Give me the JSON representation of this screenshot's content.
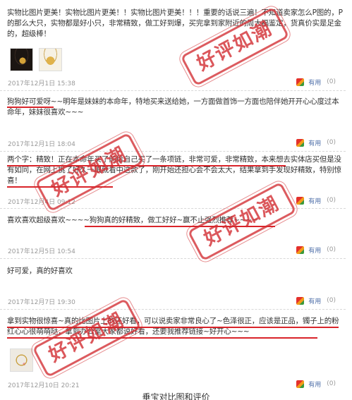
{
  "reviews": [
    {
      "text": "实物比图片更美！实物比图片更美！！实物比图片更美！！！重要的话说三遍！不知道卖家怎么P图的，P的那么大只，实物都是好小只，非常精致，做工好到爆，买完拿到家附近的周大福鉴定，货真价实是足金的，超级棒！",
      "date": "2017年12月1日  15:38",
      "useful": "有用",
      "count": "(0)"
    },
    {
      "text": "狗狗好可爱呀~~明年是妹妹的本命年，特地买来送给她，一方面做首饰一方面也陪伴她开开心心度过本命年，妹妹很喜欢~~~",
      "date": "2017年12月1日  18:04",
      "useful": "有用",
      "count": "(0)"
    },
    {
      "text": "两个字：精致！正在本命年买了前给自己买了一条项链，非常可爱，非常精致，本来想去实体店买但是没有如同，在网上挑了好久一眼就看中这款了，刚开始还担心会不会太大，结果拿到手发现好精致，特别惊喜！",
      "date": "2017年12月4日  09:12",
      "useful": "有用",
      "count": "(0)"
    },
    {
      "text": "喜欢喜欢超级喜欢~~~~狗狗真的好精致，做工好好~赢不止强烈推荐~~~~",
      "date": "2017年12月5日  10:54",
      "useful": "有用",
      "count": "(0)"
    },
    {
      "text": "好可爱，真的好喜欢",
      "date": "2017年12月7日  19:30",
      "useful": "有用",
      "count": "(0)"
    },
    {
      "text": "拿到实物很惊喜~真的比图片上的还好看，可以说卖家非常良心了~色泽很正，应该是正品，镯子上的粉红心心很萌萌哒，拿到办公室大家都说好看，还要我推荐链接~好开心~~~",
      "date": "2017年12月10日  20:21",
      "useful": "有用",
      "count": "(0)"
    }
  ],
  "stamp_text": "好评如潮",
  "caption": "垂宝对比图和评价"
}
